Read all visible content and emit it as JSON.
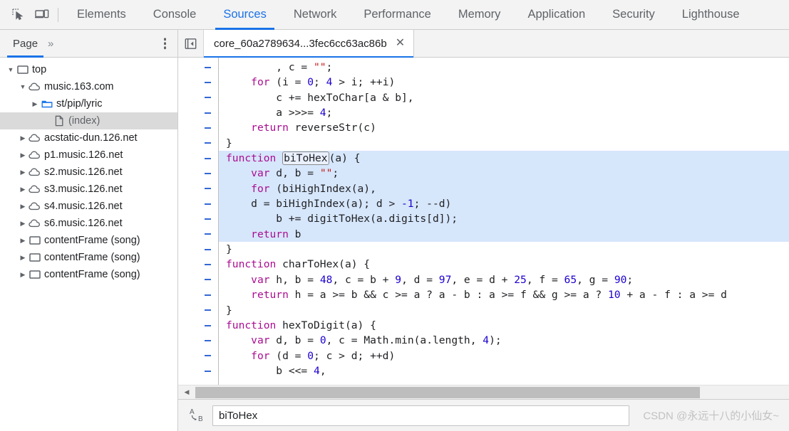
{
  "toolbar": {
    "inspect_icon": "inspect-element-icon",
    "device_icon": "device-toolbar-icon",
    "tabs": [
      {
        "label": "Elements",
        "active": false
      },
      {
        "label": "Console",
        "active": false
      },
      {
        "label": "Sources",
        "active": true
      },
      {
        "label": "Network",
        "active": false
      },
      {
        "label": "Performance",
        "active": false
      },
      {
        "label": "Memory",
        "active": false
      },
      {
        "label": "Application",
        "active": false
      },
      {
        "label": "Security",
        "active": false
      },
      {
        "label": "Lighthouse",
        "active": false
      }
    ],
    "accent_color": "#1a73e8"
  },
  "navigator": {
    "tab_label": "Page",
    "more_tabs_label": "»",
    "kebab_label": "more-options",
    "tree": [
      {
        "label": "top",
        "icon": "frame-icon",
        "indent": 0,
        "twisty": "down",
        "selected": false,
        "muted": false
      },
      {
        "label": "music.163.com",
        "icon": "cloud-icon",
        "indent": 1,
        "twisty": "down",
        "selected": false,
        "muted": false
      },
      {
        "label": "st/pip/lyric",
        "icon": "folder-icon",
        "indent": 2,
        "twisty": "right",
        "selected": false,
        "muted": false
      },
      {
        "label": "(index)",
        "icon": "document-icon",
        "indent": 3,
        "twisty": "none",
        "selected": true,
        "muted": true
      },
      {
        "label": "acstatic-dun.126.net",
        "icon": "cloud-icon",
        "indent": 1,
        "twisty": "right",
        "selected": false,
        "muted": false
      },
      {
        "label": "p1.music.126.net",
        "icon": "cloud-icon",
        "indent": 1,
        "twisty": "right",
        "selected": false,
        "muted": false
      },
      {
        "label": "s2.music.126.net",
        "icon": "cloud-icon",
        "indent": 1,
        "twisty": "right",
        "selected": false,
        "muted": false
      },
      {
        "label": "s3.music.126.net",
        "icon": "cloud-icon",
        "indent": 1,
        "twisty": "right",
        "selected": false,
        "muted": false
      },
      {
        "label": "s4.music.126.net",
        "icon": "cloud-icon",
        "indent": 1,
        "twisty": "right",
        "selected": false,
        "muted": false
      },
      {
        "label": "s6.music.126.net",
        "icon": "cloud-icon",
        "indent": 1,
        "twisty": "right",
        "selected": false,
        "muted": false
      },
      {
        "label": "contentFrame (song)",
        "icon": "frame-icon",
        "indent": 1,
        "twisty": "right",
        "selected": false,
        "muted": false
      },
      {
        "label": "contentFrame (song)",
        "icon": "frame-icon",
        "indent": 1,
        "twisty": "right",
        "selected": false,
        "muted": false
      },
      {
        "label": "contentFrame (song)",
        "icon": "frame-icon",
        "indent": 1,
        "twisty": "right",
        "selected": false,
        "muted": false
      }
    ]
  },
  "editor": {
    "nav_toggle_icon": "collapse-sidebar-icon",
    "tab_title": "core_60a2789634...3fec6cc63ac86b",
    "tab_close_icon": "close-icon",
    "gutter_dash_count": 21,
    "lines": [
      {
        "hl": false,
        "tokens": [
          {
            "t": "        , c = ",
            "c": "plain"
          },
          {
            "t": "\"\"",
            "c": "str"
          },
          {
            "t": ";",
            "c": "plain"
          }
        ]
      },
      {
        "hl": false,
        "tokens": [
          {
            "t": "    ",
            "c": "plain"
          },
          {
            "t": "for",
            "c": "kw"
          },
          {
            "t": " (i = ",
            "c": "plain"
          },
          {
            "t": "0",
            "c": "num"
          },
          {
            "t": "; ",
            "c": "plain"
          },
          {
            "t": "4",
            "c": "num"
          },
          {
            "t": " > i; ++i)",
            "c": "plain"
          }
        ]
      },
      {
        "hl": false,
        "tokens": [
          {
            "t": "        c += hexToChar[a & b],",
            "c": "plain"
          }
        ]
      },
      {
        "hl": false,
        "tokens": [
          {
            "t": "        a >>>= ",
            "c": "plain"
          },
          {
            "t": "4",
            "c": "num"
          },
          {
            "t": ";",
            "c": "plain"
          }
        ]
      },
      {
        "hl": false,
        "tokens": [
          {
            "t": "    ",
            "c": "plain"
          },
          {
            "t": "return",
            "c": "kw"
          },
          {
            "t": " reverseStr(c)",
            "c": "plain"
          }
        ]
      },
      {
        "hl": false,
        "tokens": [
          {
            "t": "}",
            "c": "plain"
          }
        ]
      },
      {
        "hl": true,
        "rename": "biToHex",
        "tokens": [
          {
            "t": "",
            "c": "plain"
          },
          {
            "t": "function",
            "c": "kw"
          },
          {
            "t": " ",
            "c": "plain"
          },
          {
            "t": "__RENAME__",
            "c": "plain"
          },
          {
            "t": "(a) {",
            "c": "plain"
          }
        ]
      },
      {
        "hl": true,
        "tokens": [
          {
            "t": "    ",
            "c": "plain"
          },
          {
            "t": "var",
            "c": "kw"
          },
          {
            "t": " d, b = ",
            "c": "plain"
          },
          {
            "t": "\"\"",
            "c": "str"
          },
          {
            "t": ";",
            "c": "plain"
          }
        ]
      },
      {
        "hl": true,
        "tokens": [
          {
            "t": "    ",
            "c": "plain"
          },
          {
            "t": "for",
            "c": "kw"
          },
          {
            "t": " (biHighIndex(a),",
            "c": "plain"
          }
        ]
      },
      {
        "hl": true,
        "tokens": [
          {
            "t": "    d = biHighIndex(a); d > ",
            "c": "plain"
          },
          {
            "t": "-1",
            "c": "num"
          },
          {
            "t": "; --d)",
            "c": "plain"
          }
        ]
      },
      {
        "hl": true,
        "tokens": [
          {
            "t": "        b += digitToHex(a.digits[d]);",
            "c": "plain"
          }
        ]
      },
      {
        "hl": true,
        "tokens": [
          {
            "t": "    ",
            "c": "plain"
          },
          {
            "t": "return",
            "c": "kw"
          },
          {
            "t": " b",
            "c": "plain"
          }
        ]
      },
      {
        "hl": false,
        "tokens": [
          {
            "t": "}",
            "c": "plain"
          }
        ]
      },
      {
        "hl": false,
        "tokens": [
          {
            "t": "",
            "c": "plain"
          },
          {
            "t": "function",
            "c": "kw"
          },
          {
            "t": " charToHex(a) {",
            "c": "plain"
          }
        ]
      },
      {
        "hl": false,
        "tokens": [
          {
            "t": "    ",
            "c": "plain"
          },
          {
            "t": "var",
            "c": "kw"
          },
          {
            "t": " h, b = ",
            "c": "plain"
          },
          {
            "t": "48",
            "c": "num"
          },
          {
            "t": ", c = b + ",
            "c": "plain"
          },
          {
            "t": "9",
            "c": "num"
          },
          {
            "t": ", d = ",
            "c": "plain"
          },
          {
            "t": "97",
            "c": "num"
          },
          {
            "t": ", e = d + ",
            "c": "plain"
          },
          {
            "t": "25",
            "c": "num"
          },
          {
            "t": ", f = ",
            "c": "plain"
          },
          {
            "t": "65",
            "c": "num"
          },
          {
            "t": ", g = ",
            "c": "plain"
          },
          {
            "t": "90",
            "c": "num"
          },
          {
            "t": ";",
            "c": "plain"
          }
        ]
      },
      {
        "hl": false,
        "tokens": [
          {
            "t": "    ",
            "c": "plain"
          },
          {
            "t": "return",
            "c": "kw"
          },
          {
            "t": " h = a >= b && c >= a ? a - b : a >= f && g >= a ? ",
            "c": "plain"
          },
          {
            "t": "10",
            "c": "num"
          },
          {
            "t": " + a - f : a >= d",
            "c": "plain"
          }
        ]
      },
      {
        "hl": false,
        "tokens": [
          {
            "t": "}",
            "c": "plain"
          }
        ]
      },
      {
        "hl": false,
        "tokens": [
          {
            "t": "",
            "c": "plain"
          },
          {
            "t": "function",
            "c": "kw"
          },
          {
            "t": " hexToDigit(a) {",
            "c": "plain"
          }
        ]
      },
      {
        "hl": false,
        "tokens": [
          {
            "t": "    ",
            "c": "plain"
          },
          {
            "t": "var",
            "c": "kw"
          },
          {
            "t": " d, b = ",
            "c": "plain"
          },
          {
            "t": "0",
            "c": "num"
          },
          {
            "t": ", c = Math.min(a.length, ",
            "c": "plain"
          },
          {
            "t": "4",
            "c": "num"
          },
          {
            "t": ");",
            "c": "plain"
          }
        ]
      },
      {
        "hl": false,
        "tokens": [
          {
            "t": "    ",
            "c": "plain"
          },
          {
            "t": "for",
            "c": "kw"
          },
          {
            "t": " (d = ",
            "c": "plain"
          },
          {
            "t": "0",
            "c": "num"
          },
          {
            "t": "; c > d; ++d)",
            "c": "plain"
          }
        ]
      },
      {
        "hl": false,
        "tokens": [
          {
            "t": "        b <<= ",
            "c": "plain"
          },
          {
            "t": "4",
            "c": "num"
          },
          {
            "t": ",",
            "c": "plain"
          }
        ]
      }
    ],
    "scroll_left_arrow": "scroll-left-arrow-icon"
  },
  "status": {
    "rename_icon": "rename-ab-icon",
    "rename_value": "biToHex",
    "rename_placeholder": "",
    "watermark": "CSDN @永远十八的小仙女~"
  }
}
